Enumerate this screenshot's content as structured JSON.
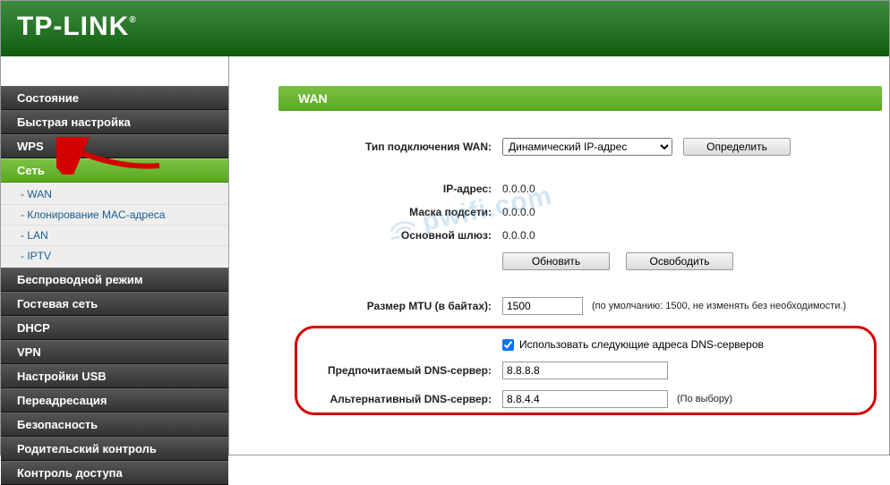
{
  "brand": "TP-LINK",
  "sidebar": {
    "items": [
      {
        "label": "Состояние"
      },
      {
        "label": "Быстрая настройка"
      },
      {
        "label": "WPS"
      },
      {
        "label": "Сеть",
        "active": true,
        "children": [
          {
            "label": "- WAN"
          },
          {
            "label": "- Клонирование MAC-адреса"
          },
          {
            "label": "- LAN"
          },
          {
            "label": "- IPTV"
          }
        ]
      },
      {
        "label": "Беспроводной режим"
      },
      {
        "label": "Гостевая сеть"
      },
      {
        "label": "DHCP"
      },
      {
        "label": "VPN"
      },
      {
        "label": "Настройки USB"
      },
      {
        "label": "Переадресация"
      },
      {
        "label": "Безопасность"
      },
      {
        "label": "Родительский контроль"
      },
      {
        "label": "Контроль доступа"
      }
    ]
  },
  "panel": {
    "title": "WAN"
  },
  "wan": {
    "conn_type_label": "Тип подключения WAN:",
    "conn_type_value": "Динамический IP-адрес",
    "detect_btn": "Определить",
    "ip_label": "IP-адрес:",
    "ip_value": "0.0.0.0",
    "mask_label": "Маска подсети:",
    "mask_value": "0.0.0.0",
    "gw_label": "Основной шлюз:",
    "gw_value": "0.0.0.0",
    "renew_btn": "Обновить",
    "release_btn": "Освободить",
    "mtu_label": "Размер MTU (в байтах):",
    "mtu_value": "1500",
    "mtu_hint": "(по умолчанию: 1500, не изменять без необходимости.)",
    "use_dns_label": "Использовать следующие адреса DNS-серверов",
    "dns1_label": "Предпочитаемый DNS-сервер:",
    "dns1_value": "8.8.8.8",
    "dns2_label": "Альтернативный DNS-сервер:",
    "dns2_value": "8.8.4.4",
    "dns2_hint": "(По выбору)"
  },
  "watermark": "pwifi.com"
}
